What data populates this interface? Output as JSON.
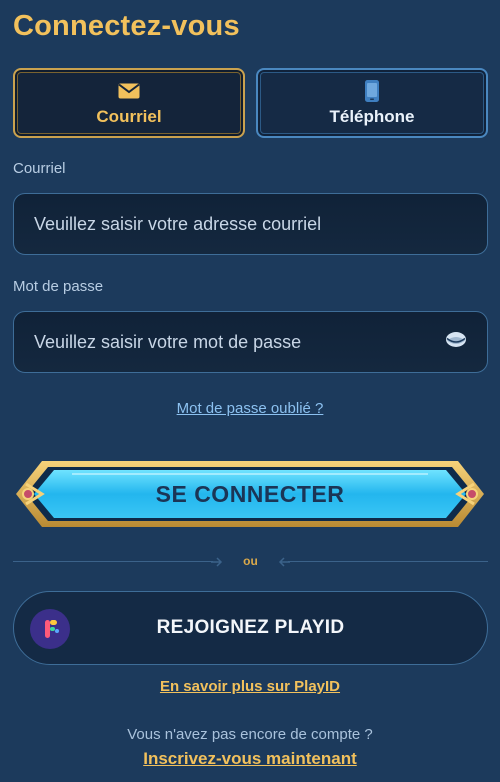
{
  "page": {
    "title": "Connectez-vous"
  },
  "tabs": [
    {
      "label": "Courriel",
      "icon": "envelope-icon",
      "active": true
    },
    {
      "label": "Téléphone",
      "icon": "phone-icon",
      "active": false
    }
  ],
  "email": {
    "label": "Courriel",
    "placeholder": "Veuillez saisir votre adresse courriel",
    "value": ""
  },
  "password": {
    "label": "Mot de passe",
    "placeholder": "Veuillez saisir votre mot de passe",
    "value": "",
    "toggle_icon": "eye-icon"
  },
  "forgot_link": "Mot de passe oublié ?",
  "login_button": "SE CONNECTER",
  "divider_text": "ou",
  "playid": {
    "label": "REJOIGNEZ PLAYID",
    "logo": "playid-logo-icon"
  },
  "learn_more_link": "En savoir plus sur PlayID",
  "no_account_text": "Vous n'avez pas encore de compte ?",
  "signup_link": "Inscrivez-vous maintenant",
  "colors": {
    "background": "#1c3a5c",
    "gold": "#f2c15c",
    "accent_blue": "#4a88c0",
    "link_blue": "#8cc1f0"
  }
}
